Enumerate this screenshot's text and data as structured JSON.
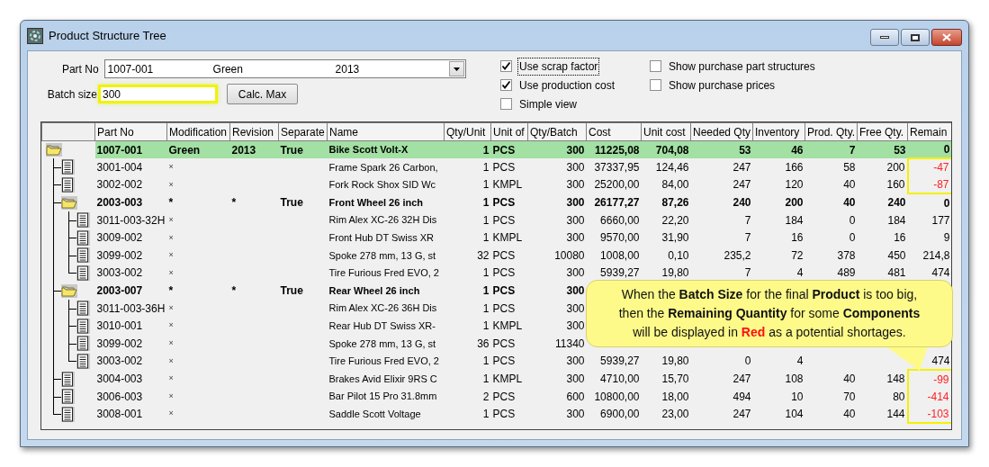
{
  "window": {
    "title": "Product Structure Tree"
  },
  "part_no": {
    "label": "Part No",
    "values": [
      "1007-001",
      "Green",
      "2013"
    ]
  },
  "batch_size": {
    "label": "Batch size",
    "value": "300",
    "highlighted": true
  },
  "calc_button": "Calc. Max",
  "options": [
    {
      "label": "Use scrap factor",
      "checked": true,
      "focused": true
    },
    {
      "label": "Use production cost",
      "checked": true,
      "focused": false
    },
    {
      "label": "Simple view",
      "checked": false,
      "focused": false
    },
    {
      "label": "Show purchase part structures",
      "checked": false,
      "focused": false
    },
    {
      "label": "Show purchase prices",
      "checked": false,
      "focused": false
    }
  ],
  "table": {
    "columns": [
      "Part No",
      "Modification",
      "Revision",
      "Separate",
      "Name",
      "Qty/Unit",
      "Unit of",
      "Qty/Batch",
      "Cost",
      "Unit cost",
      "Needed Qty",
      "Inventory",
      "Prod. Qty.",
      "Free Qty.",
      "Remain"
    ],
    "rows": [
      {
        "kind": "assembly",
        "selected": true,
        "shortage": false,
        "part_no": "1007-001",
        "modification": "Green",
        "revision": "2013",
        "separate": "True",
        "name": "Bike Scott Volt-X",
        "qty_unit": "1",
        "unit": "PCS",
        "qty_batch": "300",
        "cost": "11225,08",
        "unit_cost": "704,08",
        "needed_qty": "53",
        "inventory": "46",
        "prod_qty": "7",
        "free_qty": "53",
        "remain": "0",
        "children": [
          {
            "kind": "part",
            "selected": false,
            "shortage": true,
            "part_no": "3001-004",
            "modification": "×",
            "name": "Frame Spark 26 Carbon,",
            "qty_unit": "1",
            "unit": "PCS",
            "qty_batch": "300",
            "cost": "37337,95",
            "unit_cost": "124,46",
            "needed_qty": "247",
            "inventory": "166",
            "prod_qty": "58",
            "free_qty": "200",
            "remain": "-47"
          },
          {
            "kind": "part",
            "selected": false,
            "shortage": true,
            "part_no": "3002-002",
            "modification": "×",
            "name": "Fork Rock Shox SID Wc",
            "qty_unit": "1",
            "unit": "KMPL",
            "qty_batch": "300",
            "cost": "25200,00",
            "unit_cost": "84,00",
            "needed_qty": "247",
            "inventory": "120",
            "prod_qty": "40",
            "free_qty": "160",
            "remain": "-87"
          },
          {
            "kind": "assembly",
            "selected": false,
            "shortage": false,
            "part_no": "2003-003",
            "modification": "*",
            "revision": "*",
            "separate": "True",
            "name": "Front Wheel 26 inch",
            "qty_unit": "1",
            "unit": "PCS",
            "qty_batch": "300",
            "cost": "26177,27",
            "unit_cost": "87,26",
            "needed_qty": "240",
            "inventory": "200",
            "prod_qty": "40",
            "free_qty": "240",
            "remain": "0",
            "children": [
              {
                "kind": "part",
                "selected": false,
                "shortage": false,
                "part_no": "3011-003-32H",
                "modification": "×",
                "name": "Rim Alex XC-26 32H Dis",
                "qty_unit": "1",
                "unit": "PCS",
                "qty_batch": "300",
                "cost": "6660,00",
                "unit_cost": "22,20",
                "needed_qty": "7",
                "inventory": "184",
                "prod_qty": "0",
                "free_qty": "184",
                "remain": "177"
              },
              {
                "kind": "part",
                "selected": false,
                "shortage": false,
                "part_no": "3009-002",
                "modification": "×",
                "name": "Front Hub DT Swiss XR",
                "qty_unit": "1",
                "unit": "KMPL",
                "qty_batch": "300",
                "cost": "9570,00",
                "unit_cost": "31,90",
                "needed_qty": "7",
                "inventory": "16",
                "prod_qty": "0",
                "free_qty": "16",
                "remain": "9"
              },
              {
                "kind": "part",
                "selected": false,
                "shortage": false,
                "part_no": "3099-002",
                "modification": "×",
                "name": "Spoke 278 mm, 13 G, st",
                "qty_unit": "32",
                "unit": "PCS",
                "qty_batch": "10080",
                "cost": "1008,00",
                "unit_cost": "0,10",
                "needed_qty": "235,2",
                "inventory": "72",
                "prod_qty": "378",
                "free_qty": "450",
                "remain": "214,8"
              },
              {
                "kind": "part",
                "selected": false,
                "shortage": false,
                "part_no": "3003-002",
                "modification": "×",
                "name": "Tire Furious Fred EVO, 2",
                "qty_unit": "1",
                "unit": "PCS",
                "qty_batch": "300",
                "cost": "5939,27",
                "unit_cost": "19,80",
                "needed_qty": "7",
                "inventory": "4",
                "prod_qty": "489",
                "free_qty": "481",
                "remain": "474"
              }
            ]
          },
          {
            "kind": "assembly",
            "selected": false,
            "part_no": "2003-007",
            "modification": "*",
            "revision": "*",
            "separate": "True",
            "name": "Rear Wheel 26 inch",
            "qty_unit": "1",
            "unit": "PCS",
            "qty_batch": "300",
            "children": [
              {
                "kind": "part",
                "selected": false,
                "part_no": "3011-003-36H",
                "modification": "×",
                "name": "Rim Alex XC-26 36H Dis",
                "qty_unit": "1",
                "unit": "PCS",
                "qty_batch": "300"
              },
              {
                "kind": "part",
                "selected": false,
                "part_no": "3010-001",
                "modification": "×",
                "name": "Rear Hub DT Swiss XR-",
                "qty_unit": "1",
                "unit": "KMPL",
                "qty_batch": "300"
              },
              {
                "kind": "part",
                "selected": false,
                "part_no": "3099-002",
                "modification": "×",
                "name": "Spoke 278 mm, 13 G, st",
                "qty_unit": "36",
                "unit": "PCS",
                "qty_batch": "11340"
              },
              {
                "kind": "part",
                "selected": false,
                "shortage": false,
                "part_no": "3003-002",
                "modification": "×",
                "name": "Tire Furious Fred EVO, 2",
                "qty_unit": "1",
                "unit": "PCS",
                "qty_batch": "300",
                "cost": "5939,27",
                "unit_cost": "19,80",
                "needed_qty": "0",
                "inventory": "4",
                "remain": "474"
              }
            ]
          },
          {
            "kind": "part",
            "selected": false,
            "shortage": true,
            "part_no": "3004-003",
            "modification": "×",
            "name": "Brakes Avid Elixir 9RS C",
            "qty_unit": "1",
            "unit": "KMPL",
            "qty_batch": "300",
            "cost": "4710,00",
            "unit_cost": "15,70",
            "needed_qty": "247",
            "inventory": "108",
            "prod_qty": "40",
            "free_qty": "148",
            "remain": "-99"
          },
          {
            "kind": "part",
            "selected": false,
            "shortage": true,
            "part_no": "3006-003",
            "modification": "×",
            "name": "Bar Pilot 15 Pro 31.8mm",
            "qty_unit": "2",
            "unit": "PCS",
            "qty_batch": "600",
            "cost": "10800,00",
            "unit_cost": "18,00",
            "needed_qty": "494",
            "inventory": "10",
            "prod_qty": "70",
            "free_qty": "80",
            "remain": "-414"
          },
          {
            "kind": "part",
            "selected": false,
            "shortage": true,
            "part_no": "3008-001",
            "modification": "×",
            "name": "Saddle Scott Voltage",
            "qty_unit": "1",
            "unit": "PCS",
            "qty_batch": "300",
            "cost": "6900,00",
            "unit_cost": "23,00",
            "needed_qty": "247",
            "inventory": "104",
            "prod_qty": "40",
            "free_qty": "144",
            "remain": "-103"
          }
        ]
      }
    ]
  },
  "callout": {
    "segments": [
      {
        "kind": "plain",
        "text": "When the "
      },
      {
        "kind": "bold",
        "text": "Batch Size"
      },
      {
        "kind": "plain",
        "text": " for the final "
      },
      {
        "kind": "bold",
        "text": "Product"
      },
      {
        "kind": "plain",
        "text": " is too big,\nthen the "
      },
      {
        "kind": "bold",
        "text": "Remaining Quantity"
      },
      {
        "kind": "plain",
        "text": " for some "
      },
      {
        "kind": "bold",
        "text": "Components"
      },
      {
        "kind": "plain",
        "text": "\nwill be displayed in "
      },
      {
        "kind": "alert",
        "text": "Red"
      },
      {
        "kind": "plain",
        "text": " as a potential shortages."
      }
    ]
  }
}
